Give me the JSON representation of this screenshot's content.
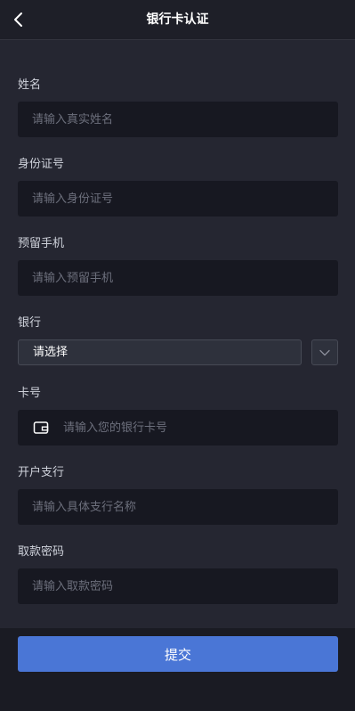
{
  "header": {
    "title": "银行卡认证",
    "back_icon": "chevron-left-icon"
  },
  "form": {
    "name": {
      "label": "姓名",
      "placeholder": "请输入真实姓名"
    },
    "id_number": {
      "label": "身份证号",
      "placeholder": "请输入身份证号"
    },
    "phone": {
      "label": "预留手机",
      "placeholder": "请输入预留手机"
    },
    "bank": {
      "label": "银行",
      "selected": "请选择",
      "arrow_icon": "chevron-down-icon"
    },
    "card_number": {
      "label": "卡号",
      "placeholder": "请输入您的银行卡号",
      "icon": "wallet-icon"
    },
    "branch": {
      "label": "开户支行",
      "placeholder": "请输入具体支行名称"
    },
    "withdraw_password": {
      "label": "取款密码",
      "placeholder": "请输入取款密码"
    }
  },
  "actions": {
    "submit_label": "提交"
  },
  "colors": {
    "accent": "#4a76d6",
    "background": "#252631",
    "field": "#171821"
  }
}
